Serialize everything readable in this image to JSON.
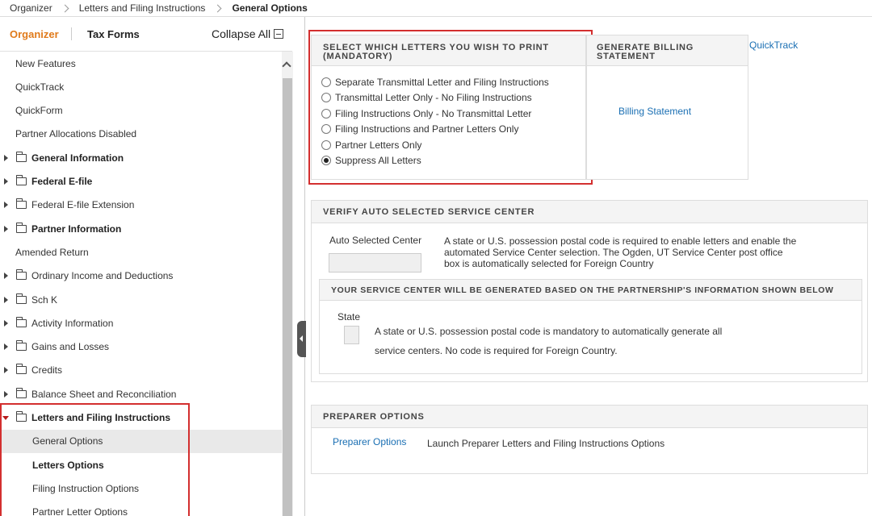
{
  "breadcrumb": [
    "Organizer",
    "Letters and Filing Instructions",
    "General Options"
  ],
  "sidebar": {
    "tabs": {
      "organizer": "Organizer",
      "tax_forms": "Tax Forms"
    },
    "collapse_all": "Collapse All",
    "items": [
      {
        "label": "New Features",
        "type": "leaf",
        "bold": false
      },
      {
        "label": "QuickTrack",
        "type": "leaf",
        "bold": false
      },
      {
        "label": "QuickForm",
        "type": "leaf",
        "bold": false
      },
      {
        "label": "Partner Allocations Disabled",
        "type": "leaf",
        "bold": false
      },
      {
        "label": "General Information",
        "type": "folder",
        "bold": true
      },
      {
        "label": "Federal E-file",
        "type": "folder",
        "bold": true
      },
      {
        "label": "Federal E-file Extension",
        "type": "folder",
        "bold": false
      },
      {
        "label": "Partner Information",
        "type": "folder",
        "bold": true
      },
      {
        "label": "Amended Return",
        "type": "leaf",
        "bold": false
      },
      {
        "label": "Ordinary Income and Deductions",
        "type": "folder",
        "bold": false
      },
      {
        "label": "Sch K",
        "type": "folder",
        "bold": false
      },
      {
        "label": "Activity Information",
        "type": "folder",
        "bold": false
      },
      {
        "label": "Gains and Losses",
        "type": "folder",
        "bold": false
      },
      {
        "label": "Credits",
        "type": "folder",
        "bold": false
      },
      {
        "label": "Balance Sheet and Reconciliation",
        "type": "folder",
        "bold": false
      },
      {
        "label": "Letters and Filing Instructions",
        "type": "folder-open",
        "bold": true
      },
      {
        "label": "General Options",
        "type": "child",
        "bold": false,
        "selected": true
      },
      {
        "label": "Letters Options",
        "type": "child",
        "bold": true
      },
      {
        "label": "Filing Instruction Options",
        "type": "child",
        "bold": false
      },
      {
        "label": "Partner Letter Options",
        "type": "child",
        "bold": false
      }
    ]
  },
  "letters_panel": {
    "title": "SELECT WHICH LETTERS YOU WISH TO PRINT (MANDATORY)",
    "options": [
      "Separate Transmittal Letter and Filing Instructions",
      "Transmittal Letter Only - No Filing Instructions",
      "Filing Instructions Only - No Transmittal Letter",
      "Filing Instructions and Partner Letters Only",
      "Partner Letters Only",
      "Suppress All Letters"
    ],
    "selected_index": 5
  },
  "billing_panel": {
    "title": "GENERATE BILLING STATEMENT",
    "link": "Billing Statement"
  },
  "quicktrack_link": "QuickTrack",
  "service_center_panel": {
    "title": "VERIFY AUTO SELECTED SERVICE CENTER",
    "auto_label": "Auto Selected Center",
    "auto_value": "",
    "auto_desc_lines": [
      "A state or U.S. possession postal code is required to enable letters and enable the",
      "automated Service Center selection. The Ogden, UT Service Center post office",
      "box is automatically selected for Foreign Country"
    ],
    "sub_title": "YOUR SERVICE CENTER WILL BE GENERATED BASED ON THE PARTNERSHIP'S INFORMATION SHOWN BELOW",
    "state_label": "State",
    "state_value": "",
    "state_desc_lines": [
      "A state or U.S. possession postal code is mandatory to automatically generate all",
      "service centers. No code is required for Foreign Country."
    ]
  },
  "preparer_panel": {
    "title": "PREPARER OPTIONS",
    "link": "Preparer Options",
    "desc": "Launch Preparer Letters and Filing Instructions Options"
  },
  "colors": {
    "accent": "#e07a1a",
    "link": "#1a6fb3",
    "highlight": "#d32f2f"
  }
}
